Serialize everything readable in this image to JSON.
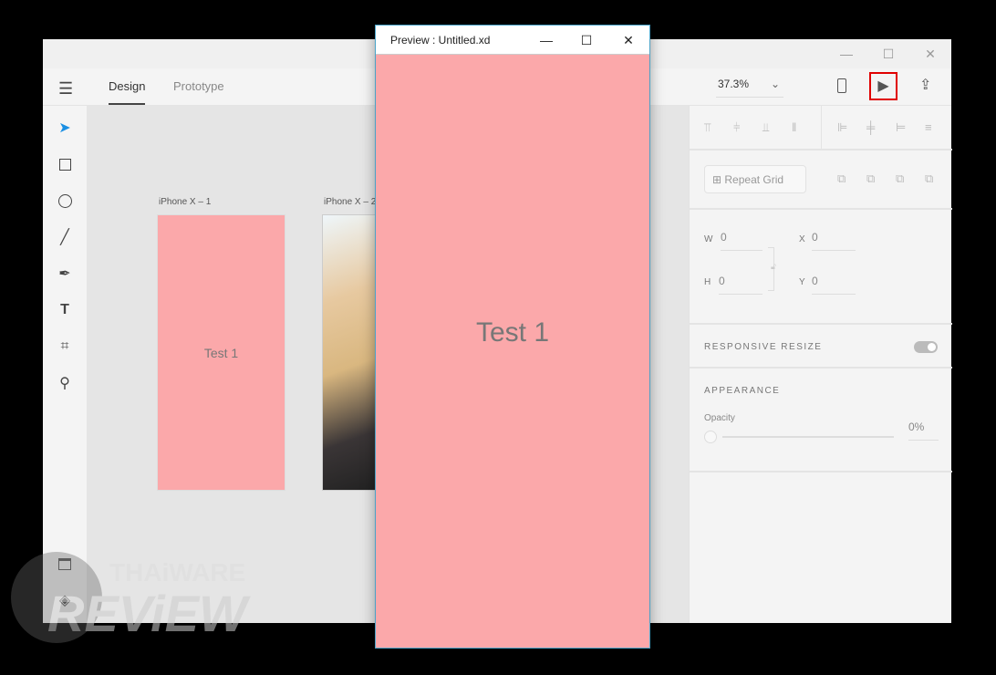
{
  "app": {
    "tabs": [
      {
        "label": "Design"
      },
      {
        "label": "Prototype"
      }
    ],
    "zoom": "37.3%"
  },
  "window_controls": {
    "minimize": "—",
    "maximize": "☐",
    "close": "✕"
  },
  "artboards": [
    {
      "label": "iPhone X – 1",
      "text": "Test 1"
    },
    {
      "label": "iPhone X – 2"
    }
  ],
  "props": {
    "repeat_grid": "Repeat Grid",
    "w_label": "W",
    "w": "0",
    "h_label": "H",
    "h": "0",
    "x_label": "X",
    "x": "0",
    "y_label": "Y",
    "y": "0",
    "responsive_resize": "RESPONSIVE RESIZE",
    "responsive_on": true,
    "appearance": "APPEARANCE",
    "opacity_label": "Opacity",
    "opacity": "0%"
  },
  "preview": {
    "title": "Preview : Untitled.xd",
    "text": "Test 1"
  },
  "watermark": {
    "line1": "THAiWARE",
    "line2": "REViEW"
  },
  "colors": {
    "artboard": "#fba8aa",
    "highlight": "#e00000"
  }
}
